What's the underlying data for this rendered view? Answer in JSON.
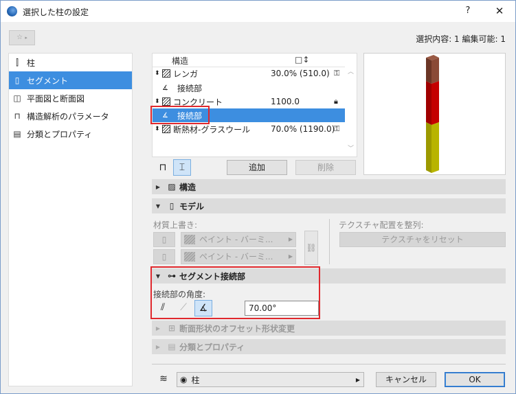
{
  "window": {
    "title": "選択した柱の設定",
    "help": "?",
    "close": "✕"
  },
  "favorites": {
    "label": "☆"
  },
  "selection_info": "選択内容: 1 編集可能: 1",
  "nav": {
    "items": [
      {
        "label": "柱",
        "icon": "column-icon"
      },
      {
        "label": "セグメント",
        "icon": "segment-icon"
      },
      {
        "label": "平面図と断面図",
        "icon": "floor-plan-section-icon"
      },
      {
        "label": "構造解析のパラメータ",
        "icon": "structural-analysis-icon"
      },
      {
        "label": "分類とプロパティ",
        "icon": "classification-icon"
      }
    ],
    "selected": 1
  },
  "segments": {
    "headers": {
      "structure": "構造",
      "size_icon": "□↕"
    },
    "rows": [
      {
        "name": "レンガ",
        "value": "30.0% (510.0)",
        "lock": "unlocked-icon",
        "type": "segment"
      },
      {
        "name": "接続部",
        "value": "",
        "lock": "",
        "type": "joint"
      },
      {
        "name": "コンクリート",
        "value": "1100.0",
        "lock": "locked-icon",
        "type": "segment"
      },
      {
        "name": "接続部",
        "value": "",
        "lock": "",
        "type": "joint",
        "selected": true
      },
      {
        "name": "断熱材-グラスウール",
        "value": "70.0% (1190.0)",
        "lock": "unlocked-icon",
        "type": "segment"
      }
    ]
  },
  "toolbar": {
    "add": "追加",
    "delete": "削除"
  },
  "sections": {
    "structure": "構造",
    "model": "モデル",
    "segment_joint": "セグメント接続部",
    "offset": "断面形状のオフセット形状変更",
    "classification": "分類とプロパティ"
  },
  "model": {
    "surface_override": "材質上書き:",
    "paint_1": "ペイント - バーミ...",
    "paint_2": "ペイント - バーミ...",
    "texture_align": "テクスチャ配置を整列:",
    "texture_reset": "テクスチャをリセット"
  },
  "joint": {
    "angle_label": "接続部の角度:",
    "angle_value": "70.00°"
  },
  "bottom": {
    "layer": "柱",
    "cancel": "キャンセル",
    "ok": "OK"
  },
  "colors": {
    "selection": "#3d8ee0",
    "highlight": "#e0282d",
    "brick": "#7a3f2b",
    "concrete": "#c00000",
    "insulation": "#b5b000"
  }
}
